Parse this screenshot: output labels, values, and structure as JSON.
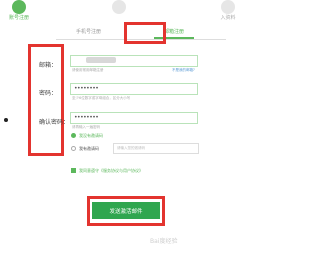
{
  "steps": [
    {
      "label": "账号注册"
    },
    {
      "label": ""
    },
    {
      "label": "入资料"
    }
  ],
  "tabs": {
    "phone": "手机号注册",
    "email": "邮箱注册"
  },
  "fields": {
    "email": {
      "label": "邮箱：",
      "hint": "请使用常用邮箱注册",
      "link": "不是我的邮箱?"
    },
    "password": {
      "label": "密码：",
      "value": "••••••••",
      "hint": "至少6位数字或字母组合，区分大小写"
    },
    "confirm": {
      "label": "确认密码：",
      "value": "••••••••",
      "hint": "请再输入一遍密码"
    }
  },
  "invite": {
    "option_no": "我没有邀请码",
    "option_yes": "我有邀请码",
    "placeholder": "请输入您的邀请码"
  },
  "agreement": "我同意遵守《服务协议与用户协议》",
  "submit_label": "发送激活邮件",
  "watermark": "Bai度经验",
  "colors": {
    "accent": "#5cb85c",
    "highlight": "#e3342f",
    "button": "#2fa64f"
  }
}
